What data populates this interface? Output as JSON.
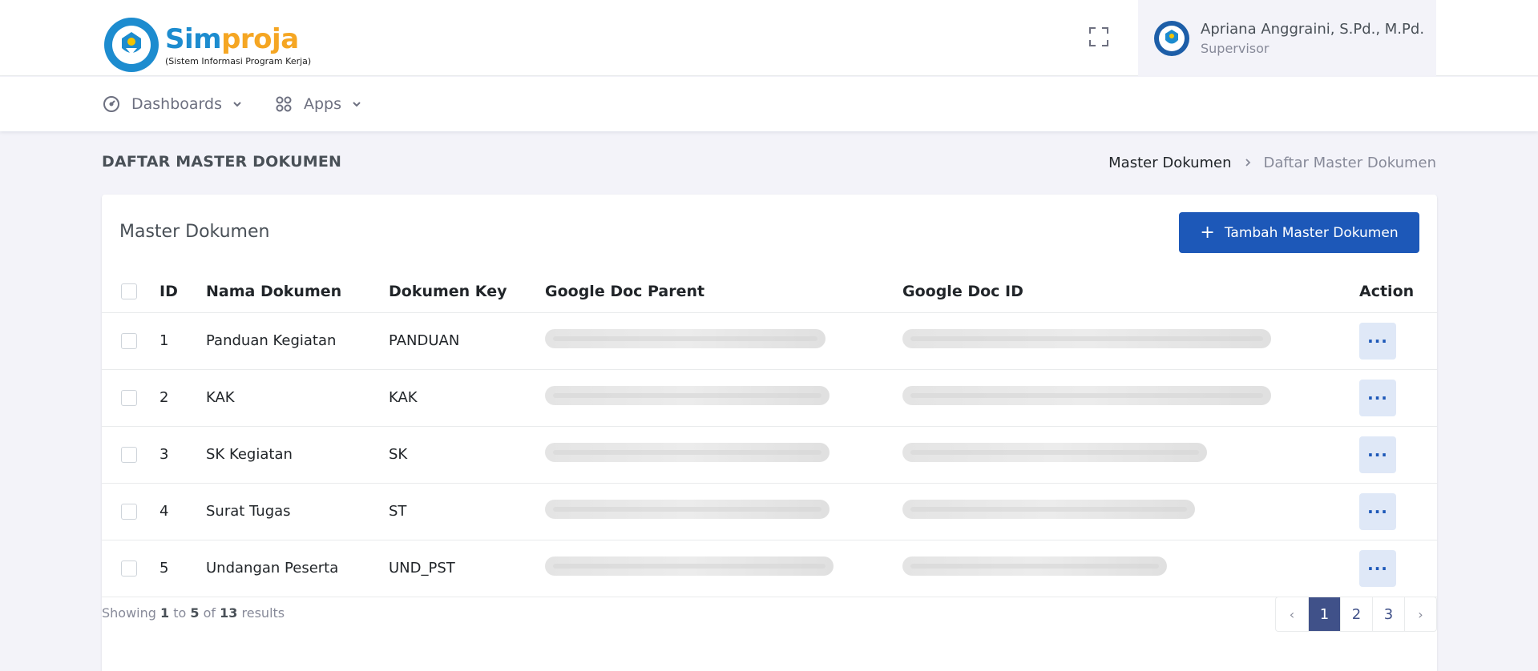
{
  "brand": {
    "title_part1": "Sim",
    "title_part2": "proja",
    "subtitle": "(Sistem Informasi Program Kerja)"
  },
  "user": {
    "name": "Apriana Anggraini, S.Pd., M.Pd.",
    "role": "Supervisor"
  },
  "nav": {
    "items": [
      {
        "label": "Dashboards",
        "icon": "gauge-icon"
      },
      {
        "label": "Apps",
        "icon": "grid-icon"
      }
    ]
  },
  "page": {
    "title": "DAFTAR MASTER DOKUMEN",
    "breadcrumb": [
      "Master Dokumen",
      "Daftar Master Dokumen"
    ]
  },
  "card": {
    "title": "Master Dokumen",
    "add_button": "Tambah Master Dokumen"
  },
  "table": {
    "headers": [
      "ID",
      "Nama Dokumen",
      "Dokumen Key",
      "Google Doc Parent",
      "Google Doc ID",
      "Action"
    ],
    "rows": [
      {
        "id": "1",
        "name": "Panduan Kegiatan",
        "key": "PANDUAN"
      },
      {
        "id": "2",
        "name": "KAK",
        "key": "KAK"
      },
      {
        "id": "3",
        "name": "SK Kegiatan",
        "key": "SK"
      },
      {
        "id": "4",
        "name": "Surat Tugas",
        "key": "ST"
      },
      {
        "id": "5",
        "name": "Undangan Peserta",
        "key": "UND_PST"
      }
    ]
  },
  "footer": {
    "showing": "Showing",
    "from": "1",
    "to_word": "to",
    "to": "5",
    "of_word": "of",
    "total": "13",
    "results": "results"
  },
  "pagination": {
    "prev": "‹",
    "pages": [
      "1",
      "2",
      "3"
    ],
    "next": "›",
    "active": "1"
  },
  "colors": {
    "primary": "#1d58b8",
    "pagination_active": "#405189",
    "brand_blue": "#1d8ccf",
    "brand_orange": "#f5a623"
  }
}
